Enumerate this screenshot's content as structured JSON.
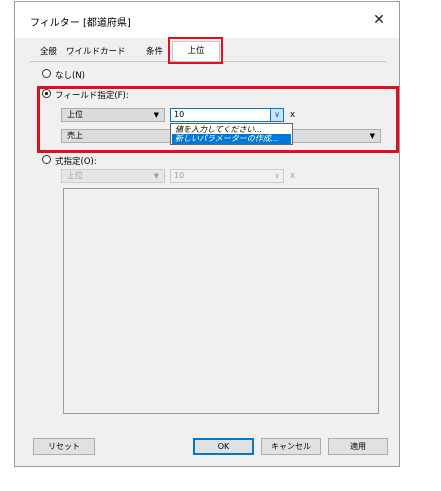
{
  "dialog": {
    "title": "フィルター [都道府県]",
    "close_glyph": "✕"
  },
  "tabs": [
    {
      "label": "全般"
    },
    {
      "label": "ワイルドカード"
    },
    {
      "label": "条件"
    },
    {
      "label": "上位",
      "active": true
    }
  ],
  "options": {
    "none_label": "なし(N)",
    "by_field_label": "フィールド指定(F):",
    "by_formula_label": "式指定(O):",
    "selected": "by_field"
  },
  "by_field": {
    "direction_value": "上位",
    "count_value": "10",
    "count_suffix": "x",
    "field_value": "売上",
    "dropdown_items": [
      {
        "label": "値を入力してください...",
        "selected": false
      },
      {
        "label": "新しいパラメーターの作成...",
        "selected": true
      }
    ]
  },
  "by_formula": {
    "direction_value": "上位",
    "count_value": "10",
    "count_suffix": "x"
  },
  "buttons": {
    "reset": "リセット",
    "ok": "OK",
    "cancel": "キャンセル",
    "apply": "適用"
  },
  "colors": {
    "highlight": "#e0101c",
    "accent": "#0078d7"
  }
}
